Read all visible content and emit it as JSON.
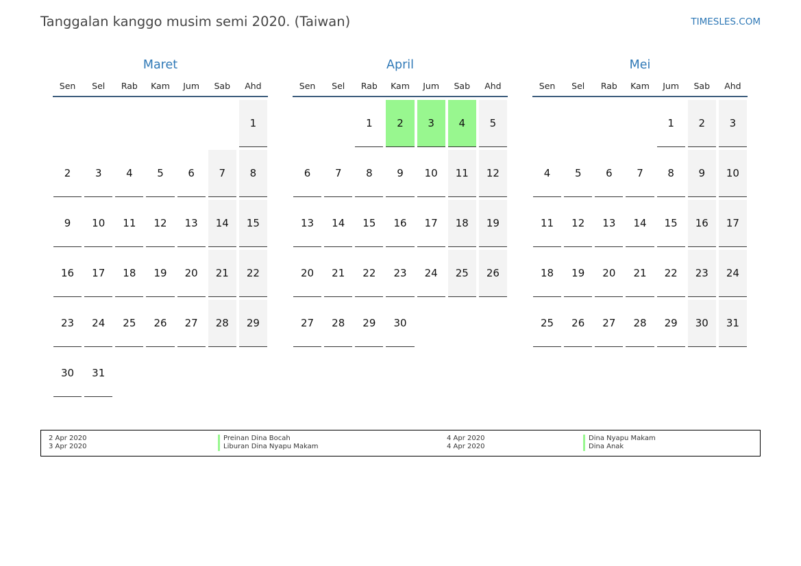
{
  "title": "Tanggalan kanggo musim semi 2020. (Taiwan)",
  "brand": "TIMESLES.COM",
  "colors": {
    "accent": "#2e78b6",
    "holiday": "#98f78f",
    "weekend": "#f3f3f3"
  },
  "weekdays": [
    "Sen",
    "Sel",
    "Rab",
    "Kam",
    "Jum",
    "Sab",
    "Ahd"
  ],
  "months": [
    {
      "name": "Maret",
      "weeks": [
        [
          "",
          "",
          "",
          "",
          "",
          "",
          "1"
        ],
        [
          "2",
          "3",
          "4",
          "5",
          "6",
          "7",
          "8"
        ],
        [
          "9",
          "10",
          "11",
          "12",
          "13",
          "14",
          "15"
        ],
        [
          "16",
          "17",
          "18",
          "19",
          "20",
          "21",
          "22"
        ],
        [
          "23",
          "24",
          "25",
          "26",
          "27",
          "28",
          "29"
        ],
        [
          "30",
          "31",
          "",
          "",
          "",
          "",
          ""
        ]
      ],
      "holidays": []
    },
    {
      "name": "April",
      "weeks": [
        [
          "",
          "",
          "1",
          "2",
          "3",
          "4",
          "5"
        ],
        [
          "6",
          "7",
          "8",
          "9",
          "10",
          "11",
          "12"
        ],
        [
          "13",
          "14",
          "15",
          "16",
          "17",
          "18",
          "19"
        ],
        [
          "20",
          "21",
          "22",
          "23",
          "24",
          "25",
          "26"
        ],
        [
          "27",
          "28",
          "29",
          "30",
          "",
          "",
          ""
        ]
      ],
      "holidays": [
        "2",
        "3",
        "4"
      ]
    },
    {
      "name": "Mei",
      "weeks": [
        [
          "",
          "",
          "",
          "",
          "1",
          "2",
          "3"
        ],
        [
          "4",
          "5",
          "6",
          "7",
          "8",
          "9",
          "10"
        ],
        [
          "11",
          "12",
          "13",
          "14",
          "15",
          "16",
          "17"
        ],
        [
          "18",
          "19",
          "20",
          "21",
          "22",
          "23",
          "24"
        ],
        [
          "25",
          "26",
          "27",
          "28",
          "29",
          "30",
          "31"
        ]
      ],
      "holidays": []
    }
  ],
  "legend": {
    "left": [
      {
        "date": "2 Apr 2020",
        "name": "Preinan Dina Bocah"
      },
      {
        "date": "3 Apr 2020",
        "name": "Liburan Dina Nyapu Makam"
      }
    ],
    "right": [
      {
        "date": "4 Apr 2020",
        "name": "Dina Nyapu Makam"
      },
      {
        "date": "4 Apr 2020",
        "name": "Dina Anak"
      }
    ]
  }
}
